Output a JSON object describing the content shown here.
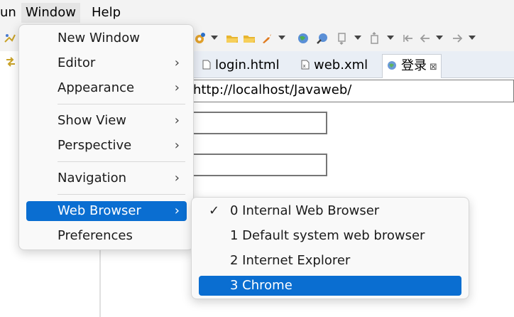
{
  "menubar": {
    "items": [
      {
        "label": "un"
      },
      {
        "label": "Window"
      },
      {
        "label": "Help"
      }
    ]
  },
  "tabs": [
    {
      "label": "login.html",
      "icon": "html-file-icon"
    },
    {
      "label": "web.xml",
      "icon": "xml-file-icon"
    },
    {
      "label": "登录",
      "icon": "globe-icon",
      "close": "⊠"
    }
  ],
  "browser": {
    "url": "http://localhost/Javaweb/"
  },
  "window_menu": {
    "items": [
      {
        "label": "New Window",
        "arrow": ""
      },
      {
        "label": "Editor",
        "arrow": "›"
      },
      {
        "label": "Appearance",
        "arrow": "›"
      },
      {
        "label": "Show View",
        "arrow": "›"
      },
      {
        "label": "Perspective",
        "arrow": "›"
      },
      {
        "label": "Navigation",
        "arrow": "›"
      },
      {
        "label": "Web Browser",
        "arrow": "›"
      },
      {
        "label": "Preferences",
        "arrow": ""
      }
    ]
  },
  "web_browser_submenu": {
    "checkmark": "✓",
    "items": [
      {
        "label": "0 Internal Web Browser",
        "checked": true
      },
      {
        "label": "1 Default system web browser",
        "checked": false
      },
      {
        "label": "2 Internet Explorer",
        "checked": false
      },
      {
        "label": "3 Chrome",
        "checked": false
      }
    ]
  },
  "colors": {
    "highlight": "#0a6ed1",
    "menu_bg": "#f9f9f9",
    "chrome_bg": "#f3f3f3"
  }
}
